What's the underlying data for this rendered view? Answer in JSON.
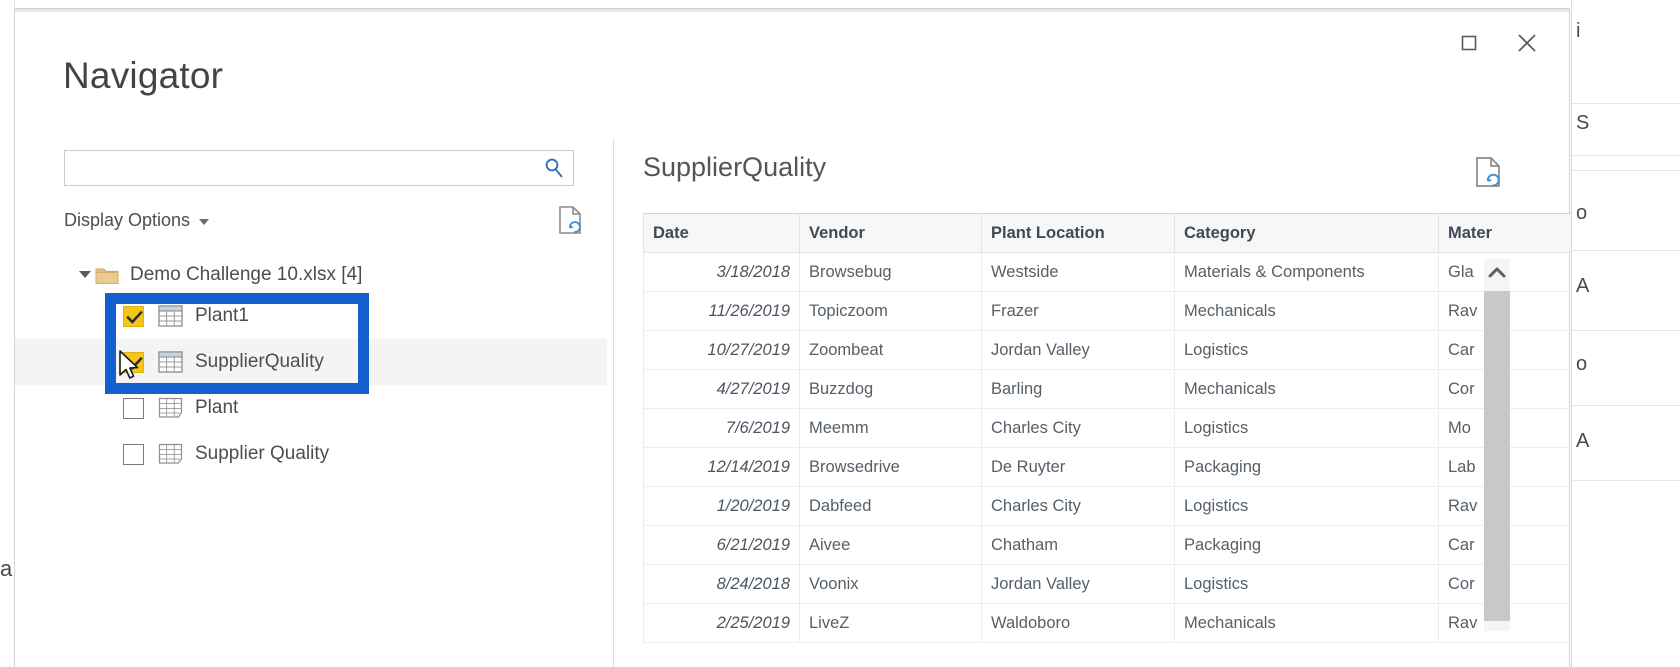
{
  "window": {
    "maximize_label": "Maximize",
    "close_label": "Close"
  },
  "dialog": {
    "title": "Navigator"
  },
  "search": {
    "value": "",
    "placeholder": "",
    "icon": "search-icon"
  },
  "left_pane": {
    "display_options_label": "Display Options",
    "refresh_icon": "refresh-document-icon",
    "tree": {
      "root": {
        "label": "Demo Challenge 10.xlsx [4]",
        "icon": "folder-icon",
        "expanded": true
      },
      "items": [
        {
          "label": "Plant1",
          "checked": true,
          "icon": "table-icon",
          "selected": false
        },
        {
          "label": "SupplierQuality",
          "checked": true,
          "icon": "table-icon",
          "selected": true
        },
        {
          "label": "Plant",
          "checked": false,
          "icon": "sheet-icon",
          "selected": false
        },
        {
          "label": "Supplier Quality",
          "checked": false,
          "icon": "sheet-icon",
          "selected": false
        }
      ]
    }
  },
  "preview": {
    "title": "SupplierQuality",
    "refresh_icon": "refresh-document-icon",
    "columns": [
      "Date",
      "Vendor",
      "Plant Location",
      "Category",
      "Mater"
    ],
    "rows": [
      [
        "3/18/2018",
        "Browsebug",
        "Westside",
        "Materials & Components",
        "Gla"
      ],
      [
        "11/26/2019",
        "Topiczoom",
        "Frazer",
        "Mechanicals",
        "Rav"
      ],
      [
        "10/27/2019",
        "Zoombeat",
        "Jordan Valley",
        "Logistics",
        "Car"
      ],
      [
        "4/27/2019",
        "Buzzdog",
        "Barling",
        "Mechanicals",
        "Cor"
      ],
      [
        "7/6/2019",
        "Meemm",
        "Charles City",
        "Logistics",
        "Mo"
      ],
      [
        "12/14/2019",
        "Browsedrive",
        "De Ruyter",
        "Packaging",
        "Lab"
      ],
      [
        "1/20/2019",
        "Dabfeed",
        "Charles City",
        "Logistics",
        "Rav"
      ],
      [
        "6/21/2019",
        "Aivee",
        "Chatham",
        "Packaging",
        "Car"
      ],
      [
        "8/24/2018",
        "Voonix",
        "Jordan Valley",
        "Logistics",
        "Cor"
      ],
      [
        "2/25/2019",
        "LiveZ",
        "Waldoboro",
        "Mechanicals",
        "Rav"
      ]
    ]
  },
  "annotation": {
    "color": "#1260cf",
    "targets": [
      "Plant1",
      "SupplierQuality"
    ]
  },
  "background": {
    "left_glyph": "a",
    "right_glyphs": [
      "i",
      "S",
      "o",
      "A",
      "o",
      "A"
    ]
  },
  "colors": {
    "accent_blue": "#1260cf",
    "checkbox_yellow": "#f5c518",
    "header_text": "#3d4a57",
    "scrollbar_thumb": "#c8c8c8"
  }
}
